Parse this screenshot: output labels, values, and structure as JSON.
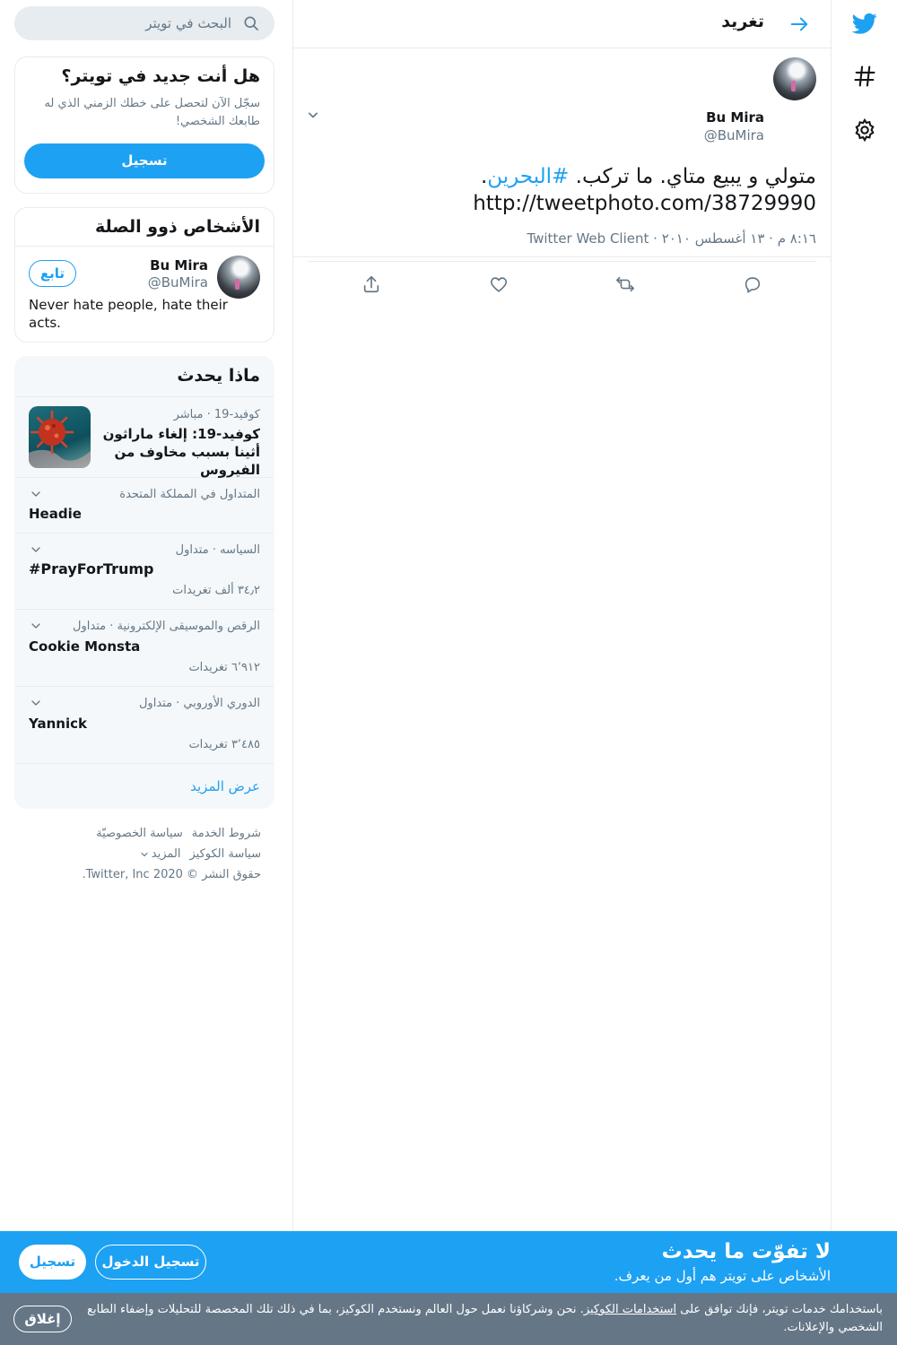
{
  "nav": {
    "icons": [
      "twitter-logo-icon",
      "hashtag-icon",
      "gear-icon"
    ],
    "brand_color": "#1da1f2"
  },
  "header": {
    "title": "تغريد"
  },
  "tweet": {
    "name": "Bu Mira",
    "handle": "@BuMira",
    "text_before": "متولي و يبيع متاي. ما تركب. ",
    "hashtag": "#البحرين",
    "text_after": ".",
    "url": "http://tweetphoto.com/38729990",
    "meta": "٨:١٦ م · ١٣ أغسطس ٢٠١٠ · Twitter Web Client"
  },
  "search": {
    "placeholder": "البحث في تويتر"
  },
  "new_to_twitter": {
    "title": "هل أنت جديد في تويتر؟",
    "description": "سجّل الآن لتحصل على خطك الزمني الذي له طابعك الشخصي!",
    "signup_label": "تسجيل"
  },
  "related": {
    "title": "الأشخاص ذوو الصلة",
    "person": {
      "name": "Bu Mira",
      "handle": "@BuMira",
      "follow_label": "تابع",
      "bio": "Never hate people, hate their acts."
    }
  },
  "trends": {
    "title": "ماذا يحدث",
    "news": {
      "context": "كوفيد-19 · مباشر",
      "headline": "كوفيد-19: إلغاء ماراثون أثينا بسبب مخاوف من الفيروس"
    },
    "items": [
      {
        "context": "المتداول في المملكة المتحدة",
        "name": "Headie",
        "count": ""
      },
      {
        "context": "السياسه · متداول",
        "name": "#PrayForTrump",
        "count": "٣٤٫٢ ألف تغريدات"
      },
      {
        "context": "الرقص والموسيقى الإلكترونية · متداول",
        "name": "Cookie Monsta",
        "count": "٦٬٩١٢ تغريدات"
      },
      {
        "context": "الدوري الأوروبي · متداول",
        "name": "Yannick",
        "count": "٣٬٤٨٥ تغريدات"
      }
    ],
    "show_more": "عرض المزيد"
  },
  "footer": {
    "terms": "شروط الخدمة",
    "privacy": "سياسة الخصوصيّة",
    "cookies": "سياسة الكوكيز",
    "more": "المزيد",
    "copyright": "حقوق النشر © 2020 Twitter, Inc."
  },
  "promo": {
    "title": "لا تفوّت ما يحدث",
    "subtitle": "الأشخاص على تويتر هم أول من يعرف.",
    "login_label": "تسجيل الدخول",
    "signup_label": "تسجيل"
  },
  "cookie": {
    "text_before": "باستخدامك خدمات تويتر، فإنك توافق على ",
    "link": "استخدامات الكوكيز",
    "text_after": ". نحن وشركاؤنا نعمل حول العالم ونستخدم الكوكيز، بما في ذلك تلك المخصصة للتحليلات وإضفاء الطابع الشخصي والإعلانات.",
    "close_label": "إغلاق"
  }
}
